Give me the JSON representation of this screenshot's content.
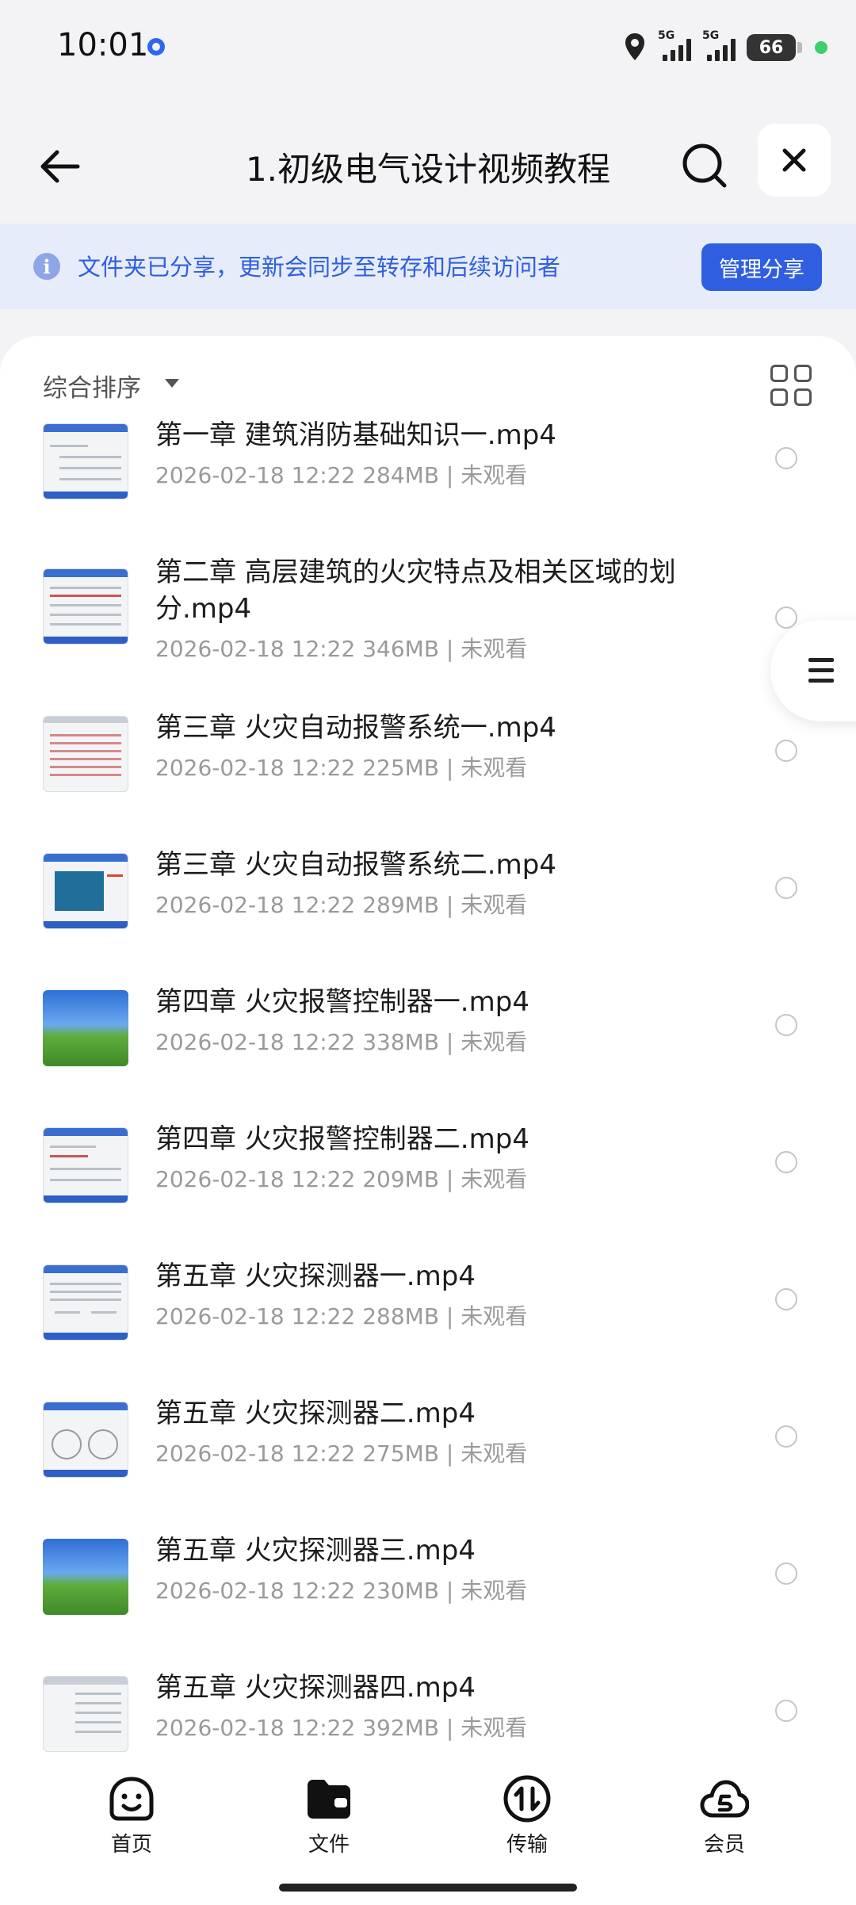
{
  "status_bar": {
    "time": "10:01",
    "signal1_label": "5G",
    "signal2_label": "5G",
    "battery": "66"
  },
  "header": {
    "title": "1.初级电气设计视频教程",
    "icons": {
      "back": "arrow-left-icon",
      "search": "search-icon",
      "close": "close-icon"
    }
  },
  "share_banner": {
    "text": "文件夹已分享，更新会同步至转存和后续访问者",
    "button": "管理分享",
    "icon": "info-icon"
  },
  "sort": {
    "label": "综合排序"
  },
  "files": [
    {
      "name": "第一章  建筑消防基础知识一.mp4",
      "meta": "2026-02-18 12:22  284MB | 未观看"
    },
    {
      "name": "第二章  高层建筑的火灾特点及相关区域的划分.mp4",
      "meta": "2026-02-18 12:22  346MB | 未观看"
    },
    {
      "name": "第三章  火灾自动报警系统一.mp4",
      "meta": "2026-02-18 12:22  225MB | 未观看"
    },
    {
      "name": "第三章  火灾自动报警系统二.mp4",
      "meta": "2026-02-18 12:22  289MB | 未观看"
    },
    {
      "name": "第四章  火灾报警控制器一.mp4",
      "meta": "2026-02-18 12:22  338MB | 未观看"
    },
    {
      "name": "第四章  火灾报警控制器二.mp4",
      "meta": "2026-02-18 12:22  209MB | 未观看"
    },
    {
      "name": "第五章  火灾探测器一.mp4",
      "meta": "2026-02-18 12:22  288MB | 未观看"
    },
    {
      "name": "第五章  火灾探测器二.mp4",
      "meta": "2026-02-18 12:22  275MB | 未观看"
    },
    {
      "name": "第五章  火灾探测器三.mp4",
      "meta": "2026-02-18 12:22  230MB | 未观看"
    },
    {
      "name": "第五章  火灾探测器四.mp4",
      "meta": "2026-02-18 12:22  392MB | 未观看"
    }
  ],
  "bottom_nav": [
    {
      "label": "首页",
      "icon": "home-face-icon"
    },
    {
      "label": "文件",
      "icon": "folder-icon"
    },
    {
      "label": "传输",
      "icon": "transfer-icon"
    },
    {
      "label": "会员",
      "icon": "member-cloud-icon"
    }
  ],
  "colors": {
    "accent": "#2f5fe0",
    "banner_bg": "#e7ecfa",
    "page_bg": "#f3f3f5"
  }
}
